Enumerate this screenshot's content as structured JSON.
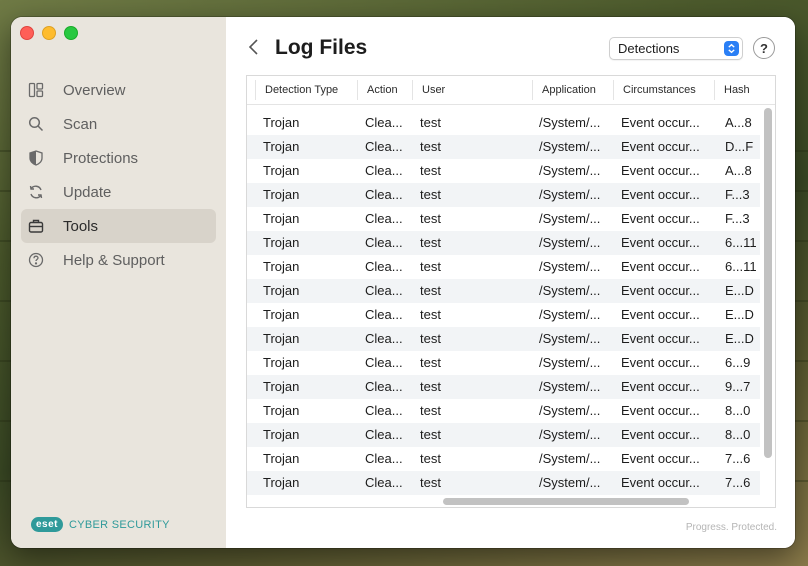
{
  "sidebar": {
    "items": [
      {
        "label": "Overview",
        "icon": "overview-icon",
        "active": false
      },
      {
        "label": "Scan",
        "icon": "search-icon",
        "active": false
      },
      {
        "label": "Protections",
        "icon": "shield-icon",
        "active": false
      },
      {
        "label": "Update",
        "icon": "refresh-icon",
        "active": false
      },
      {
        "label": "Tools",
        "icon": "briefcase-icon",
        "active": true
      },
      {
        "label": "Help & Support",
        "icon": "question-circle-icon",
        "active": false
      }
    ],
    "brand_logo": "eset",
    "brand_text": "CYBER SECURITY"
  },
  "header": {
    "title": "Log Files",
    "log_type_select": "Detections",
    "help_label": "?"
  },
  "table": {
    "columns": [
      "Detection Type",
      "Action",
      "User",
      "Application",
      "Circumstances",
      "Hash"
    ],
    "rows": [
      [
        "Trojan",
        "Clea...",
        "test",
        "/System/...",
        "Event occur...",
        "A...8"
      ],
      [
        "Trojan",
        "Clea...",
        "test",
        "/System/...",
        "Event occur...",
        "D...F"
      ],
      [
        "Trojan",
        "Clea...",
        "test",
        "/System/...",
        "Event occur...",
        "A...8"
      ],
      [
        "Trojan",
        "Clea...",
        "test",
        "/System/...",
        "Event occur...",
        "F...3"
      ],
      [
        "Trojan",
        "Clea...",
        "test",
        "/System/...",
        "Event occur...",
        "F...3"
      ],
      [
        "Trojan",
        "Clea...",
        "test",
        "/System/...",
        "Event occur...",
        "6...11"
      ],
      [
        "Trojan",
        "Clea...",
        "test",
        "/System/...",
        "Event occur...",
        "6...11"
      ],
      [
        "Trojan",
        "Clea...",
        "test",
        "/System/...",
        "Event occur...",
        "E...D"
      ],
      [
        "Trojan",
        "Clea...",
        "test",
        "/System/...",
        "Event occur...",
        "E...D"
      ],
      [
        "Trojan",
        "Clea...",
        "test",
        "/System/...",
        "Event occur...",
        "E...D"
      ],
      [
        "Trojan",
        "Clea...",
        "test",
        "/System/...",
        "Event occur...",
        "6...9"
      ],
      [
        "Trojan",
        "Clea...",
        "test",
        "/System/...",
        "Event occur...",
        "9...7"
      ],
      [
        "Trojan",
        "Clea...",
        "test",
        "/System/...",
        "Event occur...",
        "8...0"
      ],
      [
        "Trojan",
        "Clea...",
        "test",
        "/System/...",
        "Event occur...",
        "8...0"
      ],
      [
        "Trojan",
        "Clea...",
        "test",
        "/System/...",
        "Event occur...",
        "7...6"
      ],
      [
        "Trojan",
        "Clea...",
        "test",
        "/System/...",
        "Event occur...",
        "7...6"
      ]
    ]
  },
  "footer": {
    "tagline": "Progress. Protected."
  },
  "colors": {
    "accent": "#2a7ff5",
    "brand": "#2f9a9a",
    "sidebar_bg": "#e9e5dd",
    "active_item_bg": "#d8d3ca",
    "row_alt": "#f2f4f6"
  }
}
